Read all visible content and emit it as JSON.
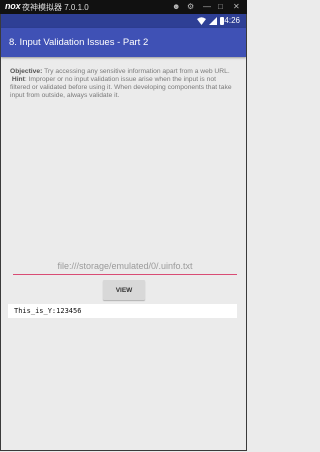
{
  "emulator": {
    "title": "夜神模拟器 7.0.1.0",
    "logo": "nox",
    "colors": {
      "bar": "#111111"
    }
  },
  "status_bar": {
    "time": "4:26",
    "icons": [
      "wifi-icon",
      "signal-icon",
      "battery-icon"
    ],
    "color": "#2e3f95"
  },
  "app_bar": {
    "title": "8. Input Validation Issues - Part 2",
    "color": "#3f51b5"
  },
  "description": {
    "objective_label": "Objective:",
    "objective_text": " Try accessing any sensitive information apart from a web URL.",
    "hint_label": "Hint",
    "hint_text": ": Improper or no input validation issue arise when the input is not filtered or validated before using it. When developing components that take input from outside, always validate it."
  },
  "form": {
    "url_value": "file:///storage/emulated/0/.uinfo.txt",
    "view_label": "VIEW",
    "output_text": "This_is_Y:123456",
    "accent_color": "#d94c74"
  }
}
